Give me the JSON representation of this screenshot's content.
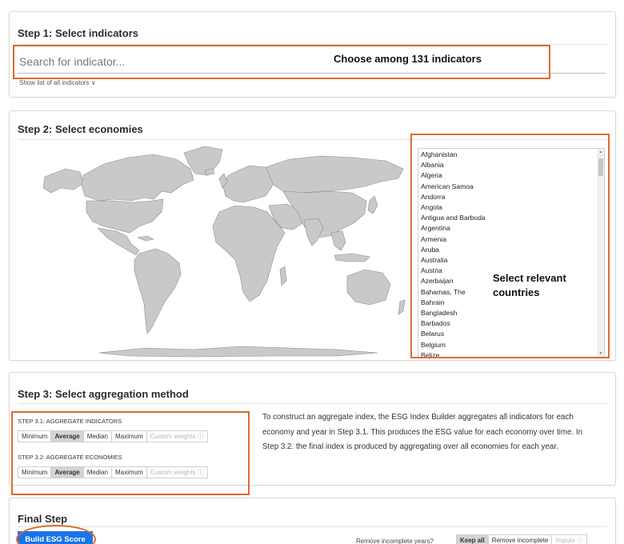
{
  "step1": {
    "title": "Step 1: Select indicators",
    "search_placeholder": "Search for indicator...",
    "show_list_label": "Show list of all indicators ∨",
    "annotation": "Choose among 131 indicators"
  },
  "step2": {
    "title": "Step 2: Select economies",
    "annotation_line1": "Select relevant",
    "annotation_line2": "countries",
    "countries": [
      "Afghanistan",
      "Albania",
      "Algeria",
      "American Samoa",
      "Andorra",
      "Angola",
      "Antigua and Barbuda",
      "Argentina",
      "Armenia",
      "Aruba",
      "Australia",
      "Austria",
      "Azerbaijan",
      "Bahamas, The",
      "Bahrain",
      "Bangladesh",
      "Barbados",
      "Belarus",
      "Belgium",
      "Belize"
    ]
  },
  "step3": {
    "title": "Step 3: Select aggregation method",
    "sub1_label": "STEP 3.1: AGGREGATE INDICATORS",
    "sub2_label": "STEP 3.2: AGGREGATE ECONOMIES",
    "options": [
      "Minimum",
      "Average",
      "Median",
      "Maximum",
      "Custom weights ⓘ"
    ],
    "selected_option": "Average",
    "description": "To construct an aggregate index, the ESG Index Builder aggregates all indicators for each economy and year in Step 3.1. This produces the ESG value for each economy over time. In Step 3.2. the final index is produced by aggregating over all economies for each year."
  },
  "final": {
    "title": "Final Step",
    "build_label": "Build ESG Score",
    "remove_label": "Remove incomplete years?",
    "remove_options": [
      "Keep all",
      "Remove incomplete",
      "Impute ⓘ"
    ],
    "remove_selected": "Keep all"
  },
  "colors": {
    "annotation_orange": "#e06a2c",
    "primary_button": "#1a73e8",
    "map_land": "#c9c9c9"
  }
}
